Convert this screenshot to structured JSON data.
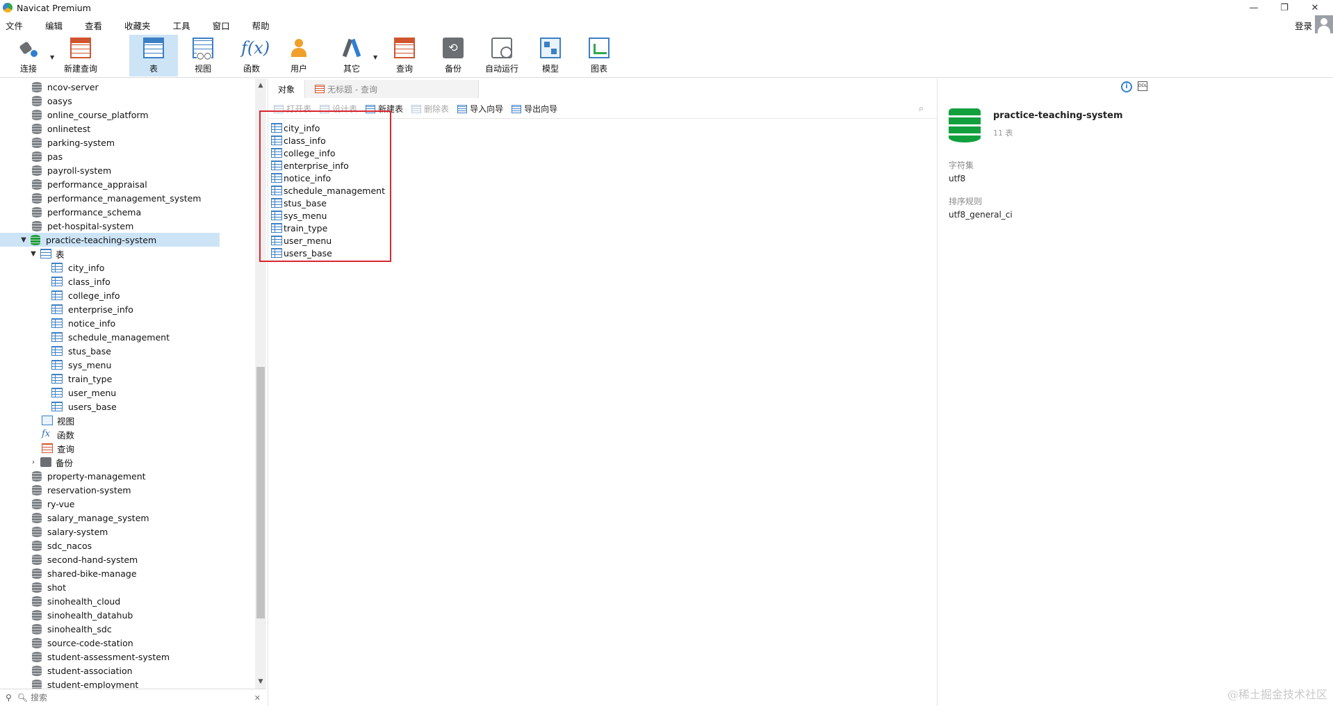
{
  "window": {
    "title": "Navicat Premium",
    "controls": {
      "minimize": "—",
      "restore": "❐",
      "close": "✕"
    }
  },
  "menu": [
    "文件",
    "编辑",
    "查看",
    "收藏夹",
    "工具",
    "窗口",
    "帮助"
  ],
  "login_label": "登录",
  "toolbar": {
    "connect": "连接",
    "new_query": "新建查询",
    "table": "表",
    "view": "视图",
    "function": "函数",
    "user": "用户",
    "other": "其它",
    "query": "查询",
    "backup": "备份",
    "auto_run": "自动运行",
    "model": "模型",
    "chart": "图表",
    "fx_glyph": "f(x)",
    "backup_glyph": "⟲"
  },
  "nav": {
    "databases_before": [
      "ncov-server",
      "oasys",
      "online_course_platform",
      "onlinetest",
      "parking-system",
      "pas",
      "payroll-system",
      "performance_appraisal",
      "performance_management_system",
      "performance_schema",
      "pet-hospital-system"
    ],
    "selected_db": "practice-teaching-system",
    "tables_folder": "表",
    "tables": [
      "city_info",
      "class_info",
      "college_info",
      "enterprise_info",
      "notice_info",
      "schedule_management",
      "stus_base",
      "sys_menu",
      "train_type",
      "user_menu",
      "users_base"
    ],
    "views_folder": "视图",
    "functions_folder": "函数",
    "queries_folder": "查询",
    "backup_folder": "备份",
    "databases_after": [
      "property-management",
      "reservation-system",
      "ry-vue",
      "salary_manage_system",
      "salary-system",
      "sdc_nacos",
      "second-hand-system",
      "shared-bike-manage",
      "shot",
      "sinohealth_cloud",
      "sinohealth_datahub",
      "sinohealth_sdc",
      "source-code-station",
      "student-assessment-system",
      "student-association",
      "student-employment"
    ],
    "search_placeholder": "搜索"
  },
  "center": {
    "tab_objects": "对象",
    "tab_query": "无标题 - 查询",
    "actions": {
      "open_table": "打开表",
      "design_table": "设计表",
      "new_table": "新建表",
      "delete_table": "删除表",
      "import_wizard": "导入向导",
      "export_wizard": "导出向导"
    },
    "objects": [
      "city_info",
      "class_info",
      "college_info",
      "enterprise_info",
      "notice_info",
      "schedule_management",
      "stus_base",
      "sys_menu",
      "train_type",
      "user_menu",
      "users_base"
    ]
  },
  "info": {
    "db_name": "practice-teaching-system",
    "table_count": "11 表",
    "charset_label": "字符集",
    "charset_value": "utf8",
    "collation_label": "排序规则",
    "collation_value": "utf8_general_ci",
    "info_glyph": "i",
    "ddl_glyph": "DDL"
  },
  "watermark": "@稀土掘金技术社区",
  "colors": {
    "accent": "#2f7fd1",
    "selection": "#cde4f7",
    "highlight_box": "#d9262e",
    "db_green": "#12a03e"
  }
}
